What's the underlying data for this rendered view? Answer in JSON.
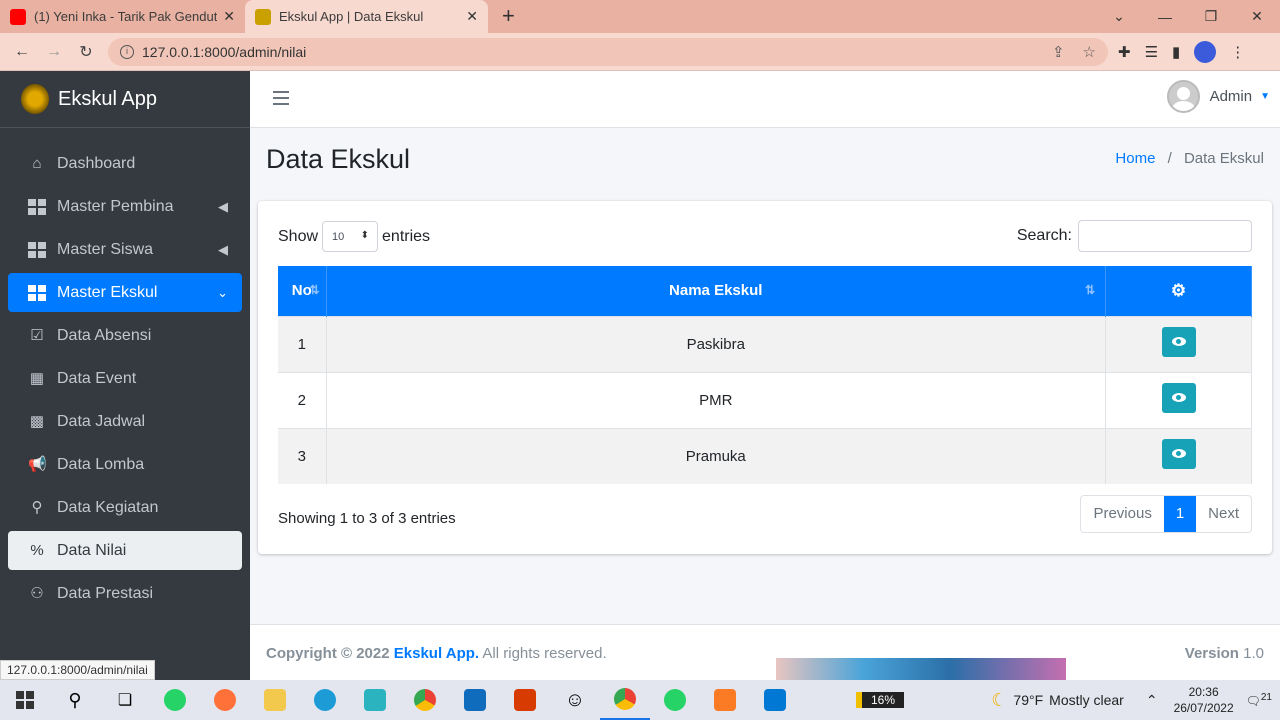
{
  "browser": {
    "tabs": [
      {
        "title": "(1) Yeni Inka - Tarik Pak Gendut ||",
        "active": false
      },
      {
        "title": "Ekskul App | Data Ekskul",
        "active": true
      }
    ],
    "url": "127.0.0.1:8000/admin/nilai",
    "status_url": "127.0.0.1:8000/admin/nilai"
  },
  "sidebar": {
    "brand": "Ekskul App",
    "items": [
      {
        "label": "Dashboard",
        "icon": "home-icon"
      },
      {
        "label": "Master Pembina",
        "icon": "grid-icon"
      },
      {
        "label": "Master Siswa",
        "icon": "grid-icon"
      },
      {
        "label": "Master Ekskul",
        "icon": "grid-icon"
      },
      {
        "label": "Data Absensi",
        "icon": "clipboard-check-icon"
      },
      {
        "label": "Data Event",
        "icon": "calendar-icon"
      },
      {
        "label": "Data Jadwal",
        "icon": "calendar-icon"
      },
      {
        "label": "Data Lomba",
        "icon": "bullhorn-icon"
      },
      {
        "label": "Data Kegiatan",
        "icon": "running-icon"
      },
      {
        "label": "Data Nilai",
        "icon": "percent-icon"
      },
      {
        "label": "Data Prestasi",
        "icon": "award-icon"
      }
    ]
  },
  "topbar": {
    "user": "Admin"
  },
  "page": {
    "title": "Data Ekskul",
    "breadcrumb_home": "Home",
    "breadcrumb_sep": "/",
    "breadcrumb_current": "Data Ekskul"
  },
  "table": {
    "show_label": "Show",
    "entries_label": "entries",
    "length_value": "10",
    "search_label": "Search:",
    "headers": [
      "No",
      "Nama Ekskul"
    ],
    "rows": [
      {
        "no": "1",
        "name": "Paskibra"
      },
      {
        "no": "2",
        "name": "PMR"
      },
      {
        "no": "3",
        "name": "Pramuka"
      }
    ],
    "info": "Showing 1 to 3 of 3 entries",
    "pager": {
      "prev": "Previous",
      "current": "1",
      "next": "Next"
    }
  },
  "footer": {
    "copyright": "Copyright © 2022",
    "app_link": "Ekskul App.",
    "rights": "All rights reserved.",
    "version_label": "Version",
    "version": "1.0"
  },
  "taskbar": {
    "battery": "16%",
    "weather_temp": "79°F",
    "weather_desc": "Mostly clear",
    "time": "20:36",
    "date": "26/07/2022",
    "notifications": "21"
  }
}
